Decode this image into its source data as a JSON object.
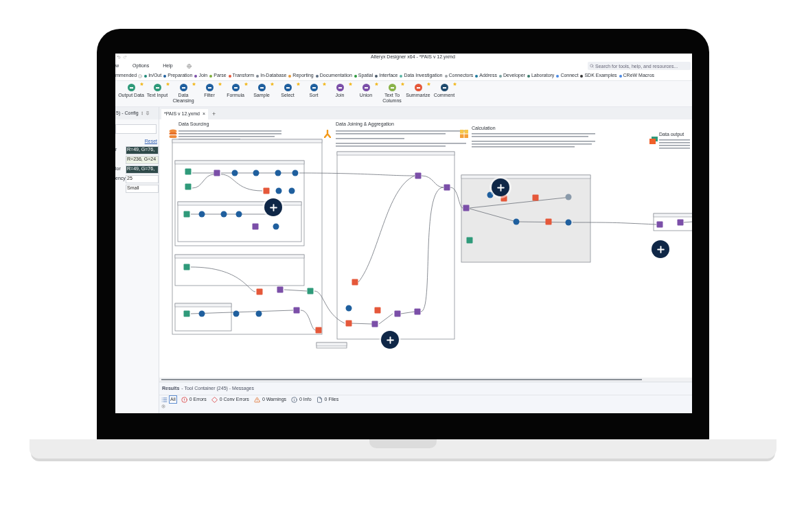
{
  "window": {
    "title": "Alteryx Designer x64 - *PAIS v 12.yxmd"
  },
  "menu": [
    "w",
    "Options",
    "Help"
  ],
  "search": {
    "placeholder": "Search for tools, help, and resources..."
  },
  "category_lead": "mmended",
  "categories": [
    {
      "label": "In/Out",
      "color": "#1f8a7a"
    },
    {
      "label": "Preparation",
      "color": "#1f5f9e"
    },
    {
      "label": "Join",
      "color": "#7b4fa8"
    },
    {
      "label": "Parse",
      "color": "#7fae3a"
    },
    {
      "label": "Transform",
      "color": "#e5583a"
    },
    {
      "label": "In-Database",
      "color": "#7d8590"
    },
    {
      "label": "Reporting",
      "color": "#e59a3a"
    },
    {
      "label": "Documentation",
      "color": "#5a6b80"
    },
    {
      "label": "Spatial",
      "color": "#2e9a3e"
    },
    {
      "label": "Interface",
      "color": "#4a5a6a"
    },
    {
      "label": "Data Investigation",
      "color": "#5ab5a5"
    },
    {
      "label": "Connectors",
      "color": "#a0a4a8"
    },
    {
      "label": "Address",
      "color": "#1f7a9e"
    },
    {
      "label": "Developer",
      "color": "#7aa0a0"
    },
    {
      "label": "Laboratory",
      "color": "#3a7a6a"
    },
    {
      "label": "Connect",
      "color": "#4a8ae5"
    },
    {
      "label": "SDK Examples",
      "color": "#333333"
    },
    {
      "label": "CReW Macros",
      "color": "#4a8ae5"
    }
  ],
  "tools": [
    {
      "label": "Output Data",
      "color": "#2f9a7a"
    },
    {
      "label": "Text Input",
      "color": "#2f9a7a"
    },
    {
      "label": "Data Cleansing",
      "color": "#1f5f9e"
    },
    {
      "label": "Filter",
      "color": "#1f5f9e"
    },
    {
      "label": "Formula",
      "color": "#1f5f9e"
    },
    {
      "label": "Sample",
      "color": "#1f5f9e"
    },
    {
      "label": "Select",
      "color": "#1f5f9e"
    },
    {
      "label": "Sort",
      "color": "#1f5f9e"
    },
    {
      "label": "Join",
      "color": "#7b4fa8"
    },
    {
      "label": "Union",
      "color": "#7b4fa8"
    },
    {
      "label": "Text To Columns",
      "color": "#8ab34a"
    },
    {
      "label": "Summarize",
      "color": "#e5583a"
    },
    {
      "label": "Comment",
      "color": "#1e4a6e"
    }
  ],
  "config_panel": {
    "title": "5) - Config",
    "reset": "Reset",
    "fields": [
      {
        "label": "r",
        "value": "R=49, G=76,",
        "color": "#2f4a4a"
      },
      {
        "value": "R=236, G=24",
        "color": "#eef3e6"
      },
      {
        "label": "lor",
        "value": "R=49, G=76,",
        "color": "#2f4a4a"
      },
      {
        "label": "ency",
        "value": "25",
        "color": "#ffffff"
      },
      {
        "value": "Small",
        "color": "#ffffff"
      }
    ]
  },
  "document_tabs": [
    {
      "label": "*PAIS v 12.yxmd",
      "selected": true,
      "close": "×"
    }
  ],
  "new_tab": "+",
  "canvas": {
    "sections": [
      {
        "title": "Data Sourcing",
        "kind": "database"
      },
      {
        "title": "Data Joining & Aggregation",
        "kind": "join"
      },
      {
        "title": "Calculation",
        "kind": "calculator"
      },
      {
        "title": "Data output",
        "kind": "output"
      }
    ]
  },
  "results": {
    "title": "Results",
    "subtitle": "- Tool Container (245) - Messages",
    "filters": [
      {
        "label": "All",
        "kind": "all",
        "selected": true
      },
      {
        "label": "0 Errors",
        "kind": "error",
        "selected": false
      },
      {
        "label": "0 Conv Errors",
        "kind": "conv",
        "selected": false
      },
      {
        "label": "0 Warnings",
        "kind": "warning",
        "selected": false
      },
      {
        "label": "0 Info",
        "kind": "info",
        "selected": false
      },
      {
        "label": "0 Files",
        "kind": "file",
        "selected": false
      }
    ]
  }
}
